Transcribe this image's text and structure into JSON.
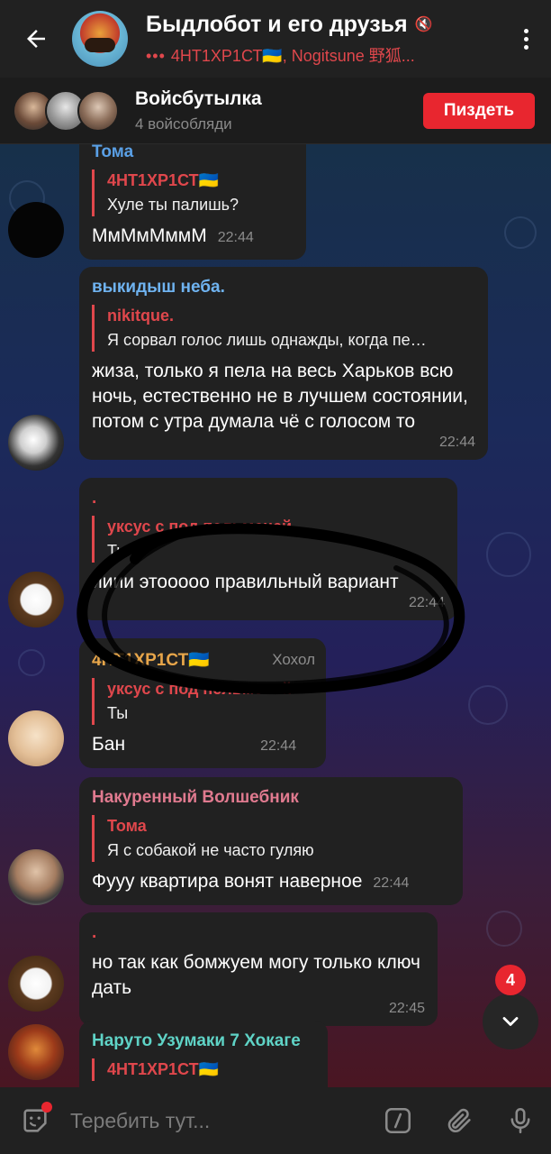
{
  "header": {
    "title": "Быдлобот и его друзья",
    "typing_indicator": "•••",
    "subtitle": "4НТ1ХР1СТ🇺🇦, Nogitsune 野狐..."
  },
  "voice_chat": {
    "title": "Войсбутылка",
    "participants": "4 войсобляди",
    "join_label": "Пиздеть"
  },
  "messages": [
    {
      "sender": "Тома",
      "sender_color": "#5aa0e6",
      "reply_author": "4НТ1ХР1СТ🇺🇦",
      "reply_text": "Хуле ты палишь?",
      "text": "МмМмМммМ",
      "time": "22:44"
    },
    {
      "sender": "выкидыш неба.",
      "sender_color": "#6fb3f0",
      "reply_author": "nikitque.",
      "reply_text": "Я сорвал голос лишь однажды, когда пе…",
      "text": "жиза, только я пела на весь Харьков всю ночь, естественно не в лучшем состоянии, потом с утра думала чё с голосом то",
      "time": "22:44"
    },
    {
      "sender": ".",
      "sender_color": "#e0474c",
      "reply_author": "уксус с под пельменей",
      "reply_text": "Ты",
      "text": "ииии этооооо правильный вариант",
      "time": "22:44"
    },
    {
      "sender": "4НТ1ХР1СТ🇺🇦",
      "sender_color": "#e8a64a",
      "badge": "Хохол",
      "reply_author": "уксус с под пельменей",
      "reply_text": "Ты",
      "text": "Бан",
      "time": "22:44"
    },
    {
      "sender": "Накуренный Волшебник",
      "sender_color": "#e07a8f",
      "reply_author": "Тома",
      "reply_text": "Я с собакой не часто гуляю",
      "text": "Фууу квартира вонят наверное",
      "time": "22:44"
    },
    {
      "sender": ".",
      "sender_color": "#e0474c",
      "text": "но так как бомжуем могу только ключ дать",
      "time": "22:45"
    },
    {
      "sender": "Наруто Узумаки 7 Хокаге",
      "sender_color": "#5fd3c6",
      "reply_author": "4НТ1ХР1СТ🇺🇦",
      "reply_text": ""
    }
  ],
  "scroll": {
    "unread_count": "4"
  },
  "composer": {
    "placeholder": "Теребить тут..."
  },
  "colors": {
    "accent": "#e8262f",
    "bubble": "#212121",
    "header": "#212121"
  }
}
